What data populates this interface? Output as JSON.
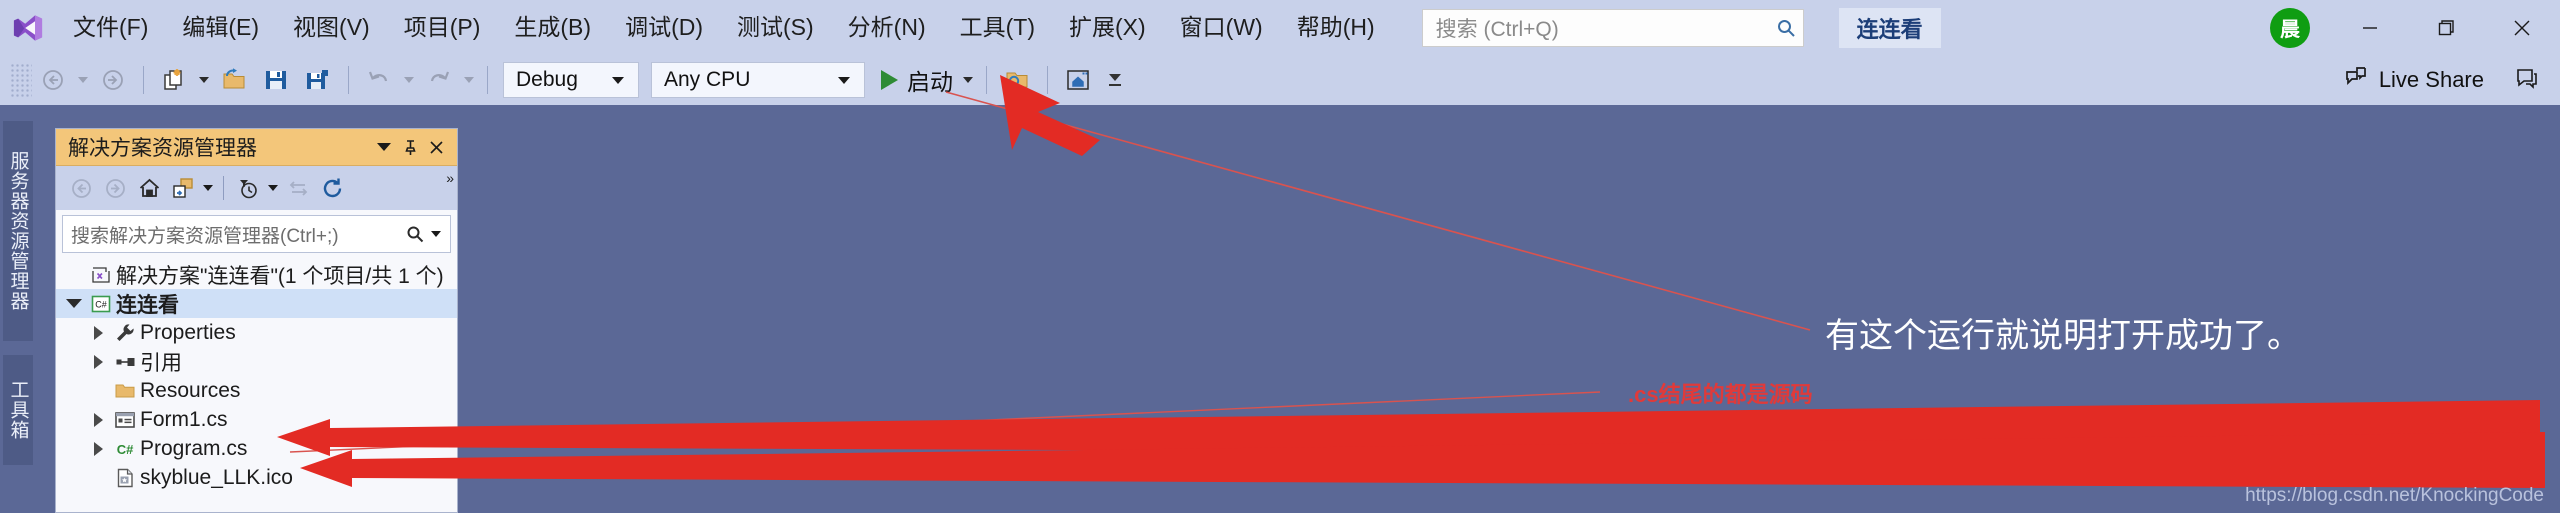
{
  "window": {
    "solution_button": "连连看",
    "avatar_initial": "晨",
    "minimize_label": "minimize",
    "restore_label": "restore",
    "close_label": "close"
  },
  "menu": {
    "items": [
      {
        "label": "文件(F)"
      },
      {
        "label": "编辑(E)"
      },
      {
        "label": "视图(V)"
      },
      {
        "label": "项目(P)"
      },
      {
        "label": "生成(B)"
      },
      {
        "label": "调试(D)"
      },
      {
        "label": "测试(S)"
      },
      {
        "label": "分析(N)"
      },
      {
        "label": "工具(T)"
      },
      {
        "label": "扩展(X)"
      },
      {
        "label": "窗口(W)"
      },
      {
        "label": "帮助(H)"
      }
    ]
  },
  "search": {
    "placeholder": "搜索 (Ctrl+Q)",
    "value": ""
  },
  "toolbar": {
    "configuration": "Debug",
    "platform": "Any CPU",
    "start_label": "启动",
    "live_share_label": "Live Share"
  },
  "left_dock": {
    "tabs": [
      {
        "label": "服务器资源管理器"
      },
      {
        "label": "工具箱"
      }
    ]
  },
  "solution_explorer": {
    "title": "解决方案资源管理器",
    "search_placeholder": "搜索解决方案资源管理器(Ctrl+;)",
    "search_value": "",
    "tree": [
      {
        "label": "解决方案\"连连看\"(1 个项目/共 1 个)",
        "icon": "solution-icon",
        "indent": 0,
        "expander": "none",
        "selected": false,
        "bold": false
      },
      {
        "label": "连连看",
        "icon": "csharp-project-icon",
        "indent": 1,
        "expander": "open",
        "selected": true,
        "bold": true
      },
      {
        "label": "Properties",
        "icon": "wrench-icon",
        "indent": 2,
        "expander": "closed",
        "selected": false,
        "bold": false
      },
      {
        "label": "引用",
        "icon": "references-icon",
        "indent": 2,
        "expander": "closed",
        "selected": false,
        "bold": false
      },
      {
        "label": "Resources",
        "icon": "folder-icon",
        "indent": 2,
        "expander": "none",
        "selected": false,
        "bold": false
      },
      {
        "label": "Form1.cs",
        "icon": "form-icon",
        "indent": 2,
        "expander": "closed",
        "selected": false,
        "bold": false
      },
      {
        "label": "Program.cs",
        "icon": "csharp-file-icon",
        "indent": 2,
        "expander": "closed",
        "selected": false,
        "bold": false
      },
      {
        "label": "skyblue_LLK.ico",
        "icon": "ico-file-icon",
        "indent": 2,
        "expander": "none",
        "selected": false,
        "bold": false
      }
    ]
  },
  "annotations": {
    "note_start": "有这个运行就说明打开成功了。",
    "note_cs": ".cs结尾的都是源码",
    "watermark": "https://blog.csdn.net/KnockingCode",
    "arrow_color": "#e32b24",
    "note_cs_color": "#e03a3a",
    "note_start_color": "#ffffff"
  }
}
